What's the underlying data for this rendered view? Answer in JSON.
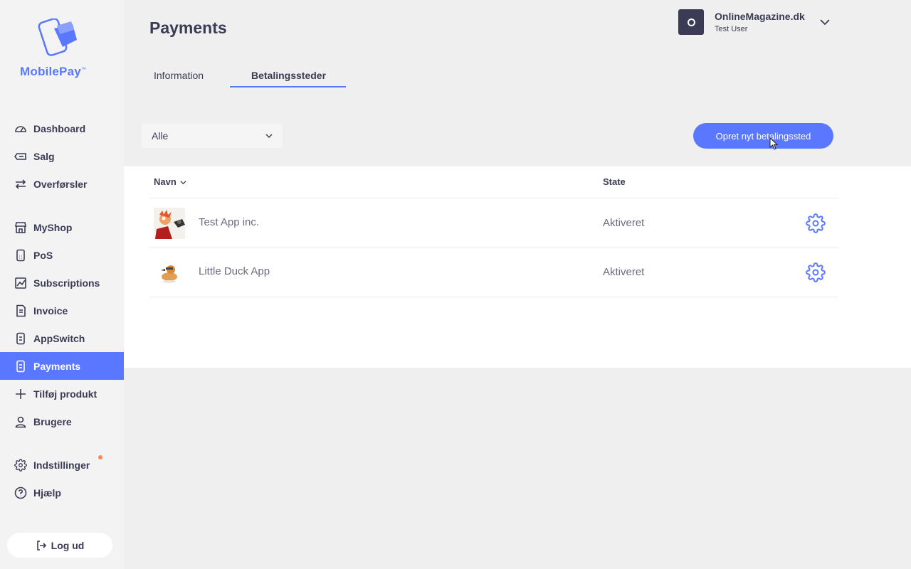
{
  "sidebar": {
    "logo_text": "MobilePay",
    "logo_tm": "™",
    "items": [
      {
        "label": "Dashboard",
        "icon": "gauge-icon"
      },
      {
        "label": "Salg",
        "icon": "ticket-icon"
      },
      {
        "label": "Overførsler",
        "icon": "transfer-arrows-icon"
      },
      {
        "label": "MyShop",
        "icon": "shop-icon"
      },
      {
        "label": "PoS",
        "icon": "pos-terminal-icon"
      },
      {
        "label": "Subscriptions",
        "icon": "subscription-chart-icon"
      },
      {
        "label": "Invoice",
        "icon": "invoice-icon"
      },
      {
        "label": "AppSwitch",
        "icon": "appswitch-phone-icon"
      },
      {
        "label": "Payments",
        "icon": "payments-phone-icon"
      },
      {
        "label": "Tilføj produkt",
        "icon": "plus-icon"
      },
      {
        "label": "Brugere",
        "icon": "user-icon"
      },
      {
        "label": "Indstillinger",
        "icon": "gear-icon"
      },
      {
        "label": "Hjælp",
        "icon": "help-icon"
      }
    ],
    "logout_label": "Log ud"
  },
  "header": {
    "title": "Payments",
    "account_name": "OnlineMagazine.dk",
    "account_user": "Test User"
  },
  "tabs": [
    {
      "label": "Information"
    },
    {
      "label": "Betalingssteder"
    }
  ],
  "filter": {
    "value": "Alle"
  },
  "cta_label": "Opret nyt betalingssted",
  "table": {
    "columns": [
      "Navn",
      "State"
    ],
    "rows": [
      {
        "name": "Test App inc.",
        "state": "Aktiveret"
      },
      {
        "name": "Little Duck App",
        "state": "Aktiveret"
      }
    ]
  },
  "colors": {
    "accent": "#5a78ff",
    "text": "#3b3b55",
    "notification": "#ff8a4c"
  }
}
